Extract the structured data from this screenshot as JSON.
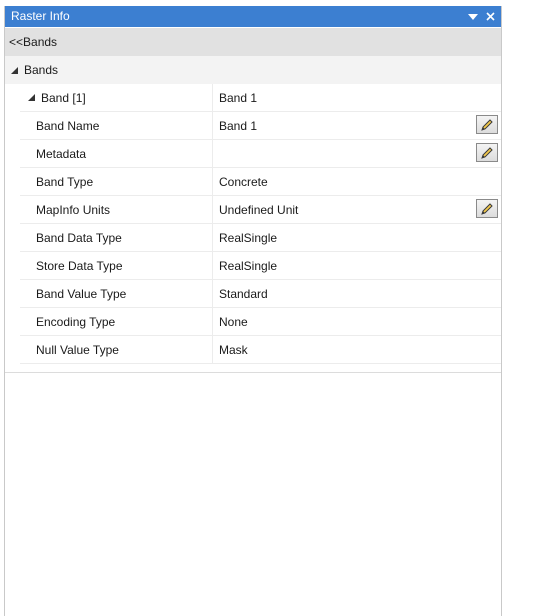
{
  "window": {
    "title": "Raster Info",
    "dropdown_icon": "chevron-down-icon",
    "close_icon": "close-icon"
  },
  "nav": {
    "back_label": "<<Bands"
  },
  "group": {
    "label": "Bands"
  },
  "band": {
    "label": "Band [1]",
    "value": "Band 1"
  },
  "properties": [
    {
      "name": "Band Name",
      "value": "Band 1",
      "editable": true
    },
    {
      "name": "Metadata",
      "value": "",
      "editable": true
    },
    {
      "name": "Band Type",
      "value": "Concrete",
      "editable": false
    },
    {
      "name": "MapInfo Units",
      "value": "Undefined Unit",
      "editable": true
    },
    {
      "name": "Band Data Type",
      "value": "RealSingle",
      "editable": false
    },
    {
      "name": "Store Data Type",
      "value": "RealSingle",
      "editable": false
    },
    {
      "name": "Band Value Type",
      "value": "Standard",
      "editable": false
    },
    {
      "name": "Encoding Type",
      "value": "None",
      "editable": false
    },
    {
      "name": "Null Value Type",
      "value": "Mask",
      "editable": false
    }
  ],
  "colors": {
    "titlebar": "#3c7fd1",
    "back_row": "#e1e1e1",
    "group_row": "#f3f3f3"
  }
}
